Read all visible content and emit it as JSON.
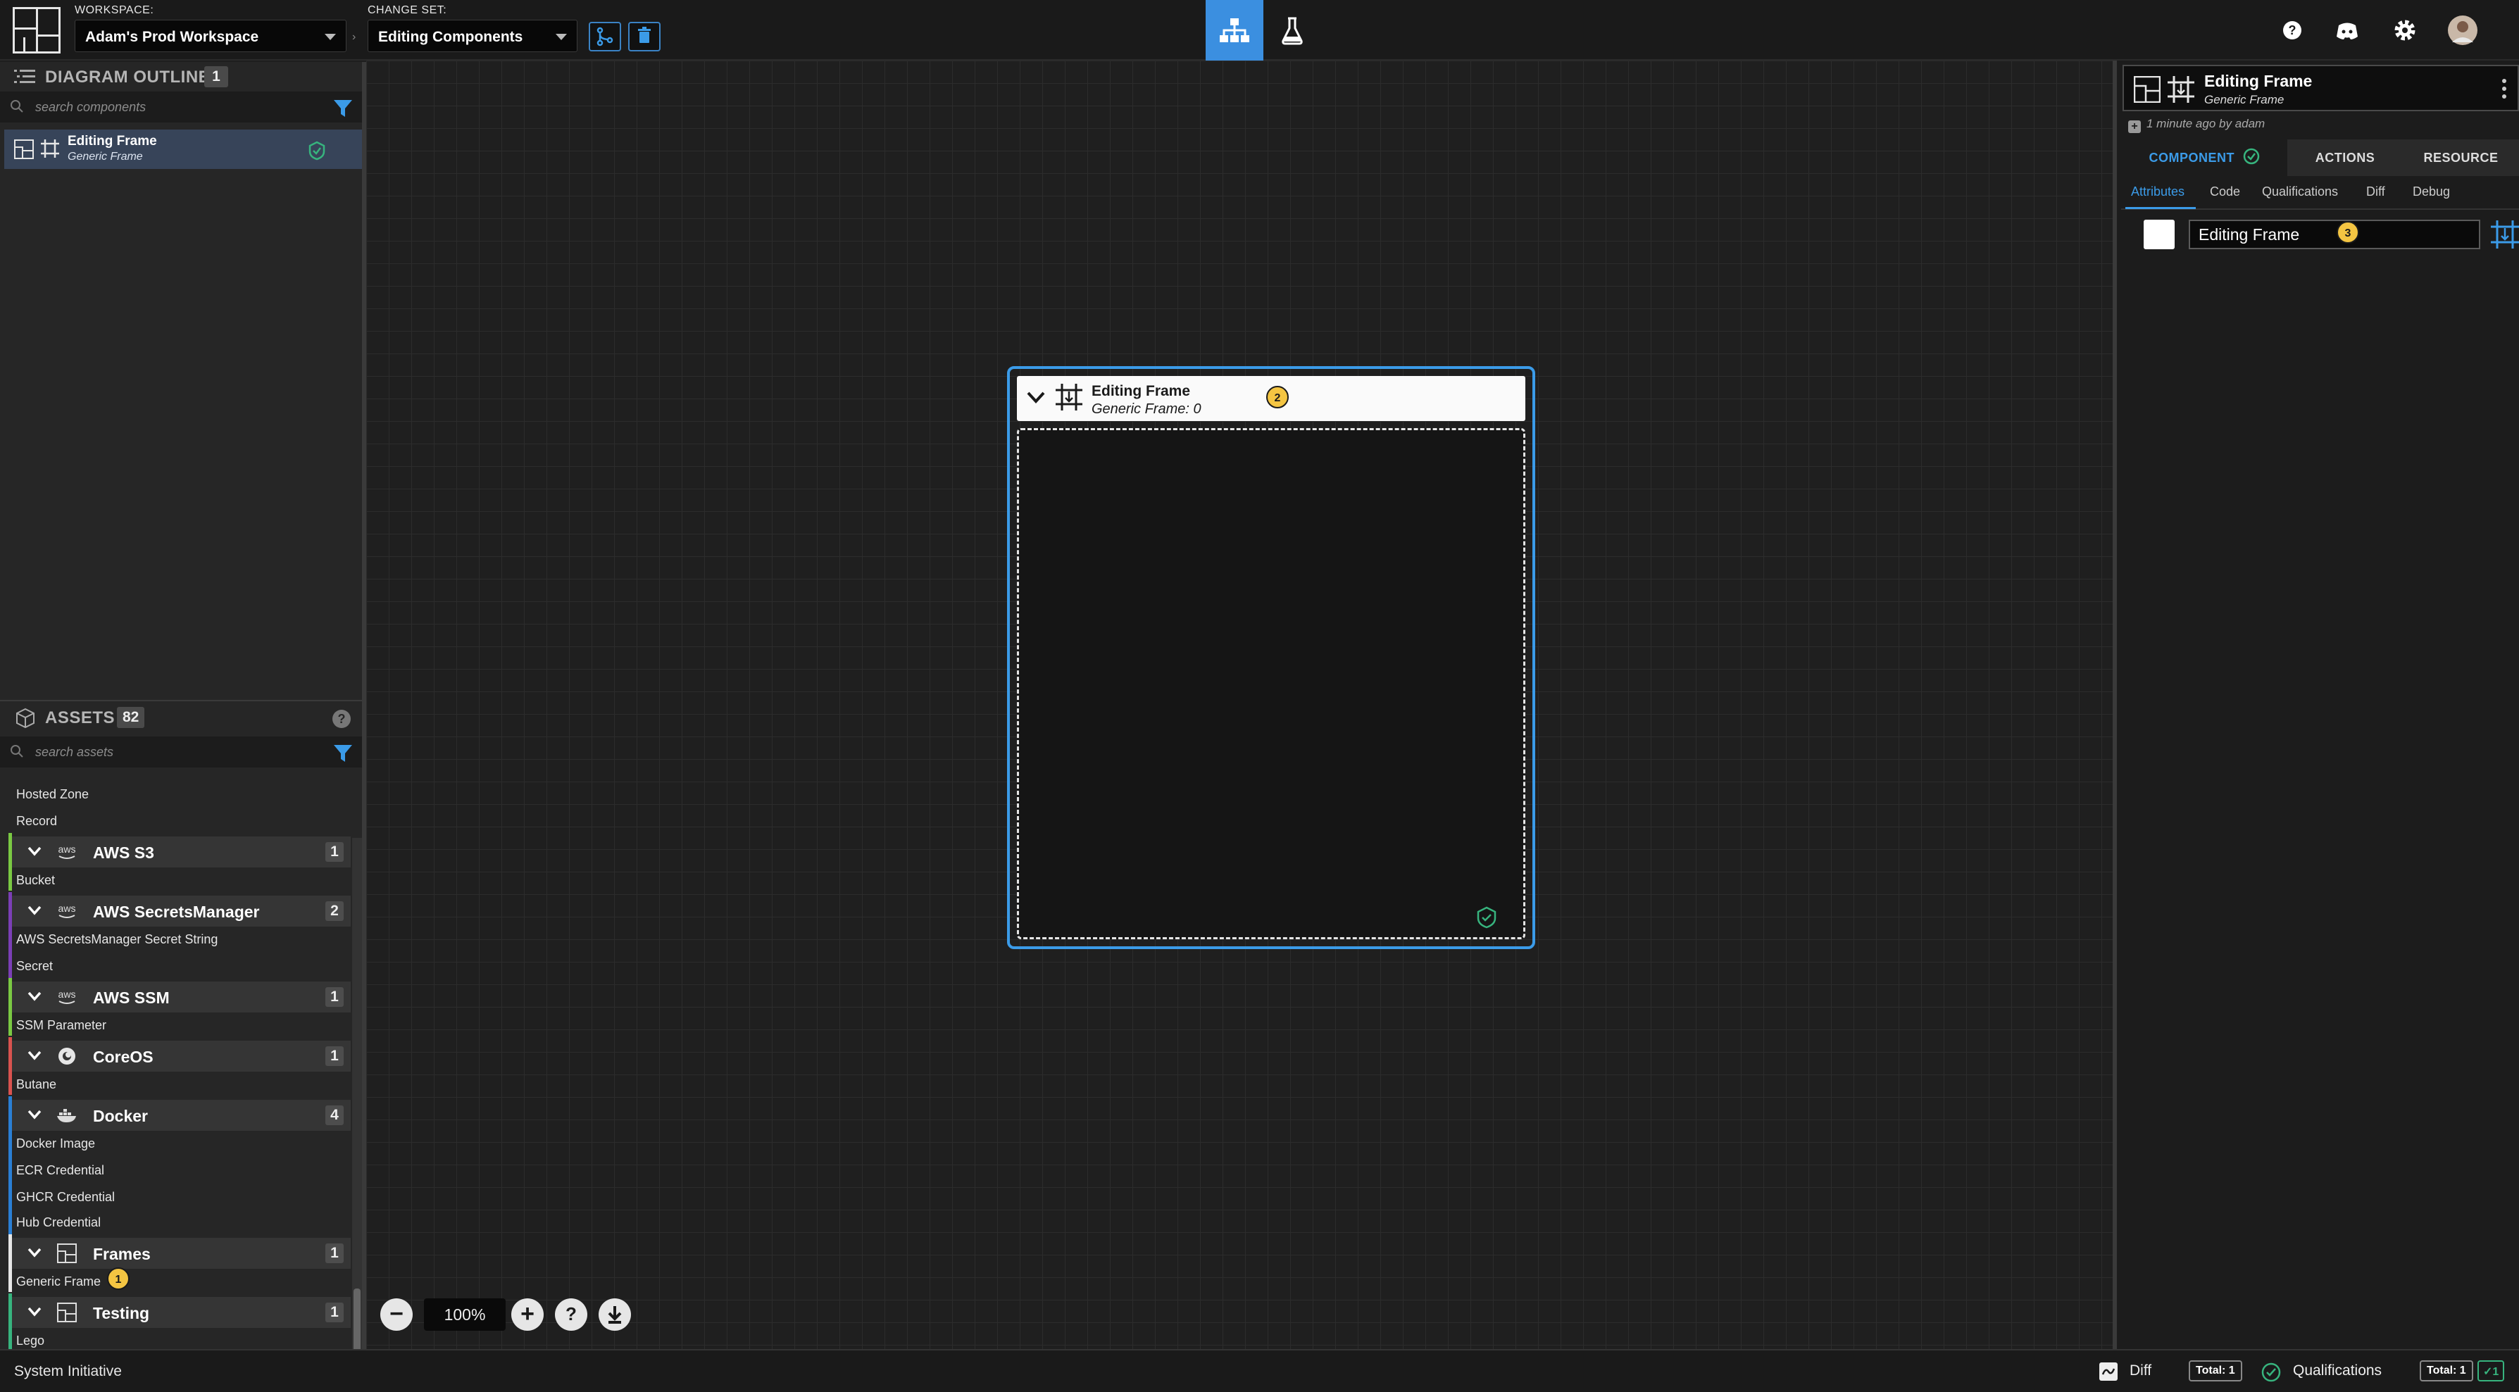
{
  "topbar": {
    "workspace_label": "WORKSPACE:",
    "workspace_value": "Adam's Prod Workspace",
    "changeset_label": "CHANGE SET:",
    "changeset_value": "Editing Components",
    "modes": [
      "diagram-mode",
      "lab-mode"
    ],
    "right_icons": [
      "help-icon",
      "discord-icon",
      "settings-gear-icon",
      "user-avatar"
    ]
  },
  "outline": {
    "title": "DIAGRAM OUTLINE",
    "count": "1",
    "search_placeholder": "search components",
    "items": [
      {
        "name": "Editing Frame",
        "type": "Generic Frame",
        "status": "qualified"
      }
    ]
  },
  "assets": {
    "title": "ASSETS",
    "count": "82",
    "search_placeholder": "search assets",
    "list": {
      "pre_items": [
        "Hosted Zone",
        "Record"
      ],
      "categories": [
        {
          "name": "AWS S3",
          "count": "1",
          "icon": "aws-icon",
          "color": "#7ac943",
          "items": [
            "Bucket"
          ]
        },
        {
          "name": "AWS SecretsManager",
          "count": "2",
          "icon": "aws-icon",
          "color": "#7b3fb6",
          "items": [
            "AWS SecretsManager Secret String",
            "Secret"
          ]
        },
        {
          "name": "AWS SSM",
          "count": "1",
          "icon": "aws-icon",
          "color": "#7ac943",
          "items": [
            "SSM Parameter"
          ]
        },
        {
          "name": "CoreOS",
          "count": "1",
          "icon": "coreos-icon",
          "color": "#d9534f",
          "items": [
            "Butane"
          ]
        },
        {
          "name": "Docker",
          "count": "4",
          "icon": "docker-icon",
          "color": "#2a7fd4",
          "items": [
            "Docker Image",
            "ECR Credential",
            "GHCR Credential",
            "Hub Credential"
          ]
        },
        {
          "name": "Frames",
          "count": "1",
          "icon": "frame-icon",
          "color": "#e6e6e6",
          "items": [
            "Generic Frame"
          ]
        },
        {
          "name": "Testing",
          "count": "1",
          "icon": "frame-icon",
          "color": "#37b47e",
          "items": [
            "Lego"
          ]
        }
      ]
    }
  },
  "canvas": {
    "frame": {
      "title": "Editing Frame",
      "subtitle": "Generic Frame: 0"
    },
    "zoom": "100%",
    "callouts": [
      "1",
      "2",
      "3"
    ]
  },
  "details": {
    "title": "Editing Frame",
    "subtitle": "Generic Frame",
    "meta": "1 minute ago by adam",
    "tabs": [
      "COMPONENT",
      "ACTIONS",
      "RESOURCE"
    ],
    "active_tab": "COMPONENT",
    "subtabs": [
      "Attributes",
      "Code",
      "Qualifications",
      "Diff",
      "Debug"
    ],
    "active_subtab": "Attributes",
    "name_value": "Editing Frame",
    "swatch_color": "#ffffff"
  },
  "statusbar": {
    "brand": "System Initiative",
    "diff_label": "Diff",
    "diff_total": "Total: 1",
    "qual_label": "Qualifications",
    "qual_total": "Total: 1",
    "qual_ok": "1"
  },
  "colors": {
    "accent": "#3b9be8",
    "success": "#37b47e",
    "callout": "#f4c542"
  }
}
